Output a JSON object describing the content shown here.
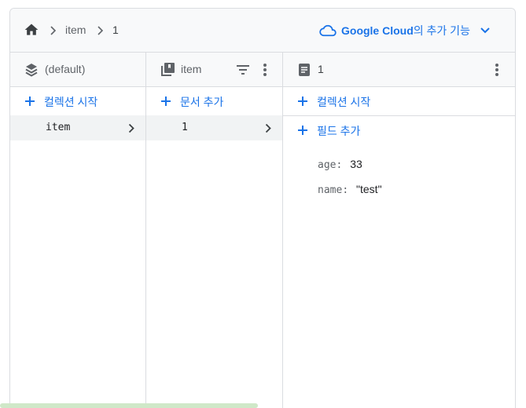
{
  "breadcrumb": {
    "items": [
      "item",
      "1"
    ]
  },
  "google_cloud": {
    "brand": "Google Cloud",
    "suffix": "의 추가 기능"
  },
  "columns": {
    "database": {
      "title": "(default)",
      "add_label": "컬렉션 시작",
      "items": [
        "item"
      ]
    },
    "collection": {
      "title": "item",
      "add_label": "문서 추가",
      "items": [
        "1"
      ]
    },
    "document": {
      "title": "1",
      "add_collection_label": "컬렉션 시작",
      "add_field_label": "필드 추가",
      "fields": [
        {
          "key": "age",
          "value": "33"
        },
        {
          "key": "name",
          "value": "\"test\""
        }
      ]
    }
  },
  "colors": {
    "accent": "#1a73e8",
    "icon": "#5f6368",
    "home": "#3c4043"
  }
}
